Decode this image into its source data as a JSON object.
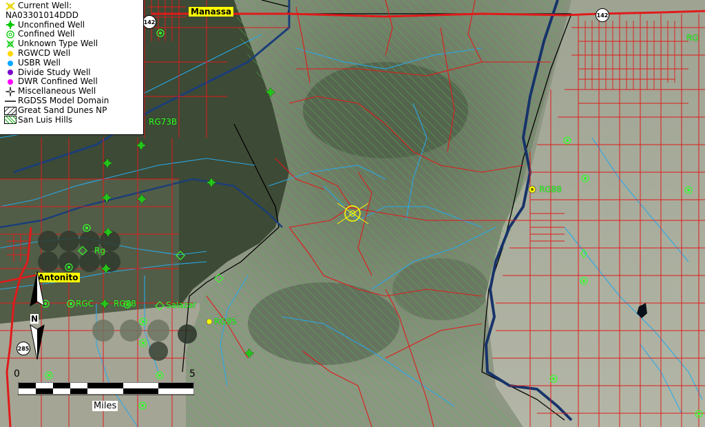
{
  "legend": {
    "current_well_title": "Current Well:",
    "current_well_id": "NA03301014DDD",
    "items": [
      {
        "label": "Unconfined Well",
        "icon": "unconfined-well-icon",
        "color": "#00c800"
      },
      {
        "label": "Confined Well",
        "icon": "confined-well-icon",
        "color": "#00c800"
      },
      {
        "label": "Unknown Type Well",
        "icon": "unknown-type-well-icon",
        "color": "#00c800"
      },
      {
        "label": "RGWCD Well",
        "icon": "rgwcd-well-icon",
        "color": "#ffd800"
      },
      {
        "label": "USBR Well",
        "icon": "usbr-well-icon",
        "color": "#00a8ff"
      },
      {
        "label": "Divide Study Well",
        "icon": "divide-study-well-icon",
        "color": "#7a00c8"
      },
      {
        "label": "DWR Confined Well",
        "icon": "dwr-confined-well-icon",
        "color": "#ff00ff"
      },
      {
        "label": "Miscellaneous Well",
        "icon": "miscellaneous-well-icon",
        "color": "#000000"
      },
      {
        "label": "RGDSS Model Domain",
        "icon": "model-domain-line-icon",
        "color": "#000000"
      },
      {
        "label": "Great Sand Dunes NP",
        "icon": "hatch-np-icon",
        "color": "#000000"
      },
      {
        "label": "San Luis Hills",
        "icon": "hatch-slh-icon",
        "color": "#00a000"
      }
    ]
  },
  "places": {
    "manassa": "Manassa",
    "antonito": "Antonito"
  },
  "highways": {
    "h142_left": "142",
    "h142_right": "142",
    "h285": "285"
  },
  "well_labels": {
    "rg_top_right": "RG",
    "rg73b": "RG73B",
    "rg88": "RG88",
    "rg95": "RG95",
    "rg_left": "Rg",
    "rgc_row": "RGC",
    "rg_row2": "RG88",
    "salazar": "Salazar"
  },
  "scale": {
    "left": "0",
    "right": "5",
    "units": "Miles"
  },
  "north": "N",
  "colors": {
    "parcel_red": "#e01a1a",
    "stream_blue": "#2aa8e8",
    "hatch_green": "#3ca83c",
    "well_green": "#35ff2a",
    "highlight_yellow": "#ffff00"
  }
}
